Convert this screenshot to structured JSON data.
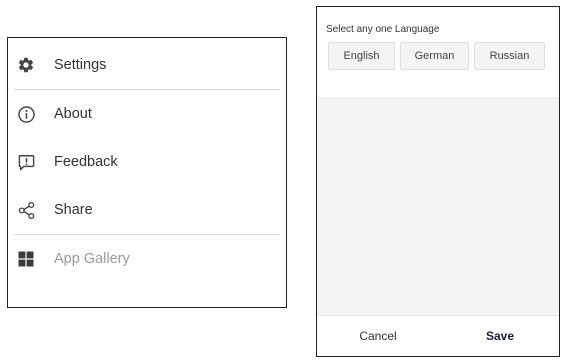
{
  "menu": {
    "items": [
      {
        "label": "Settings",
        "icon": "gear-icon",
        "enabled": true
      },
      {
        "label": "About",
        "icon": "info-icon",
        "enabled": true
      },
      {
        "label": "Feedback",
        "icon": "feedback-icon",
        "enabled": true
      },
      {
        "label": "Share",
        "icon": "share-icon",
        "enabled": true
      },
      {
        "label": "App Gallery",
        "icon": "app-grid-icon",
        "enabled": false
      }
    ]
  },
  "language_dialog": {
    "title": "Select any one Language",
    "options": [
      "English",
      "German",
      "Russian"
    ],
    "cancel_label": "Cancel",
    "save_label": "Save"
  },
  "colors": {
    "icon": "#444444",
    "disabled_icon": "#3a3a3a",
    "disabled_text": "#9a9a9a",
    "save_text": "#1b1f3a"
  }
}
